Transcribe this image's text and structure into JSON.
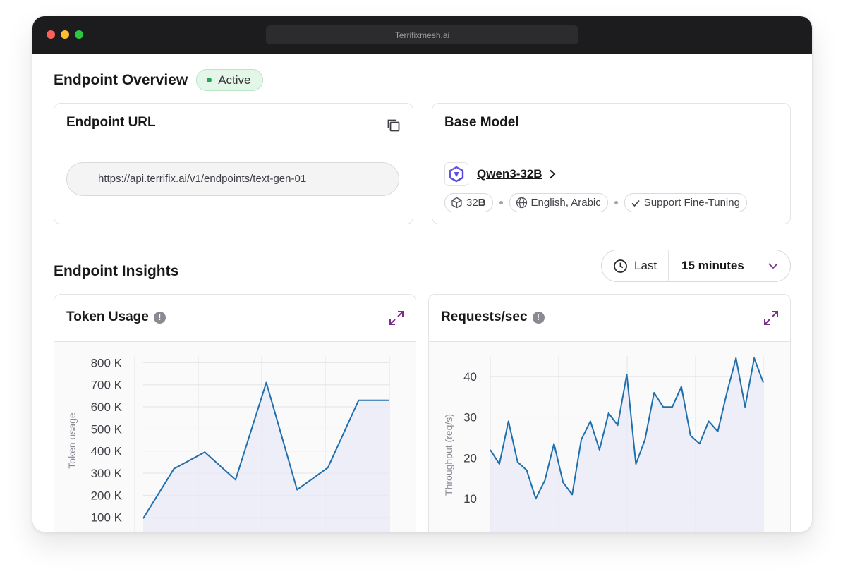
{
  "browser": {
    "url": "Terrifixmesh.ai"
  },
  "overview": {
    "title": "Endpoint Overview",
    "status": "Active"
  },
  "endpoint_url": {
    "title": "Endpoint URL",
    "url": "https://api.terrifix.ai/v1/endpoints/text-gen-01",
    "copy_icon": "copy-icon"
  },
  "base_model": {
    "title": "Base Model",
    "name": "Qwen3-32B",
    "params_prefix": "32",
    "params_suffix": "B",
    "languages": "English, Arabic",
    "finetune": "Support Fine-Tuning"
  },
  "insights": {
    "title": "Endpoint Insights",
    "range_label": "Last",
    "range_value": "15 minutes"
  },
  "colors": {
    "accent": "#7b2d8e",
    "line": "#1f6fad",
    "active_dot": "#22a55a"
  },
  "chart_data": [
    {
      "type": "area",
      "title": "Token Usage",
      "ylabel": "Token usage",
      "xlabel": "",
      "yticks": [
        "100 K",
        "200 K",
        "300 K",
        "400 K",
        "500 K",
        "600 K",
        "700 K",
        "800 K"
      ],
      "ylim": [
        0,
        830000
      ],
      "x": [
        0,
        1,
        2,
        3,
        4,
        5,
        6,
        7,
        8,
        9,
        10
      ],
      "values": [
        95000,
        320000,
        395000,
        270000,
        710000,
        225000,
        325000,
        630000,
        630000
      ],
      "grid": true
    },
    {
      "type": "area",
      "title": "Requests/sec",
      "ylabel": "Throughput (req/s)",
      "xlabel": "",
      "yticks": [
        "10",
        "20",
        "30",
        "40"
      ],
      "ylim": [
        0,
        45
      ],
      "values": [
        22,
        18.5,
        29,
        19,
        17,
        10,
        14.5,
        23.5,
        14,
        11,
        24.5,
        29,
        22,
        31,
        28,
        40.5,
        18.5,
        24.5,
        36,
        32.5,
        32.5,
        37.5,
        25.5,
        23.5,
        29,
        26.5,
        36,
        44.5,
        32.5,
        44.5,
        38.5
      ],
      "grid": true
    }
  ]
}
